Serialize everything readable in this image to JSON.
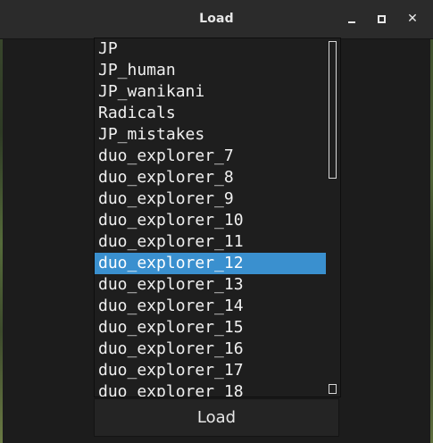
{
  "window": {
    "title": "Load",
    "min_icon": "minimize-icon",
    "max_icon": "maximize-icon",
    "close_icon": "close-icon",
    "close_glyph": "✕"
  },
  "list": {
    "items": [
      "JP",
      "JP_human",
      "JP_wanikani",
      "Radicals",
      "JP_mistakes",
      "duo_explorer_7",
      "duo_explorer_8",
      "duo_explorer_9",
      "duo_explorer_10",
      "duo_explorer_11",
      "duo_explorer_12",
      "duo_explorer_13",
      "duo_explorer_14",
      "duo_explorer_15",
      "duo_explorer_16",
      "duo_explorer_17",
      "duo_explorer_18"
    ],
    "selected_index": 10,
    "selected_color": "#3a90cf"
  },
  "footer": {
    "load_label": "Load"
  }
}
